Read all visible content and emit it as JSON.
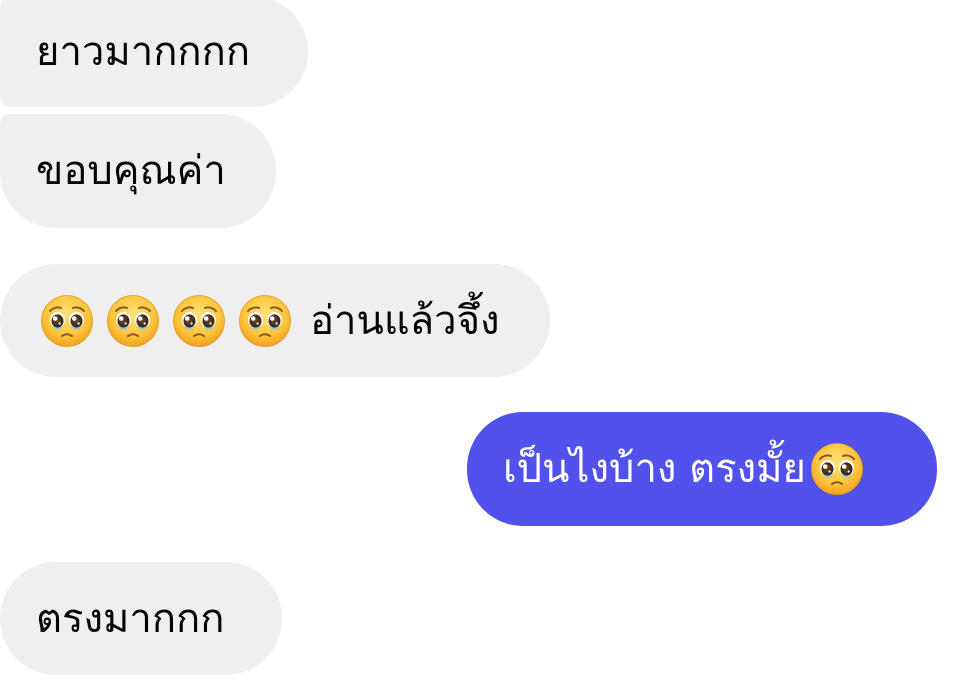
{
  "conversation": {
    "messages": [
      {
        "id": "m1",
        "direction": "incoming",
        "text": "ยาวมากกกก",
        "emoji_before": 0,
        "emoji_after": 0
      },
      {
        "id": "m2",
        "direction": "incoming",
        "text": "ขอบคุณค่า",
        "emoji_before": 0,
        "emoji_after": 0
      },
      {
        "id": "m3",
        "direction": "incoming",
        "text": "อ่านแล้วจึ้ง",
        "emoji_before": 4,
        "emoji_after": 0,
        "emoji": "pleading-face-emoji"
      },
      {
        "id": "m4",
        "direction": "outgoing",
        "text": "เป็นไงบ้าง ตรงมั้ย",
        "emoji_before": 0,
        "emoji_after": 1,
        "emoji": "pleading-face-emoji"
      },
      {
        "id": "m5",
        "direction": "incoming",
        "text": "ตรงมากกก",
        "emoji_before": 0,
        "emoji_after": 0
      }
    ]
  },
  "colors": {
    "incoming_bubble": "#efefef",
    "incoming_text": "#050505",
    "outgoing_bubble": "#5152ec",
    "outgoing_text": "#ffffff",
    "background": "#ffffff"
  }
}
